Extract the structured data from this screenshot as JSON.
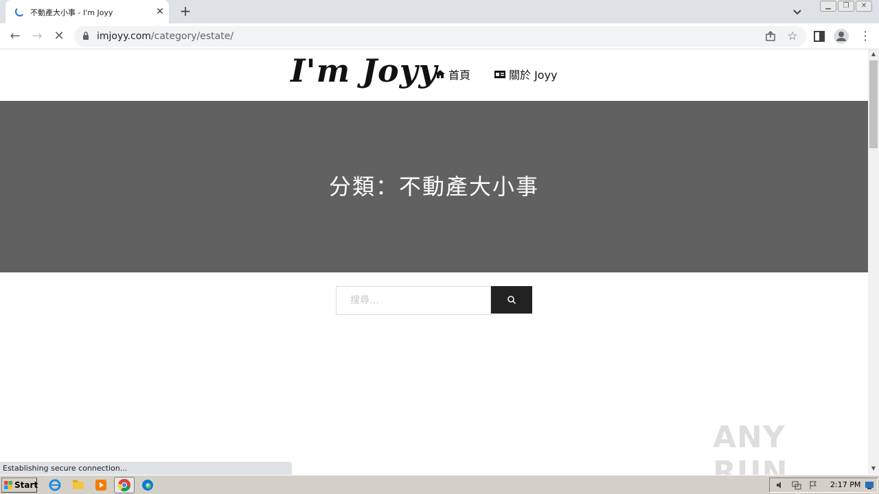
{
  "browser": {
    "tab_title": "不動產大小事 - I'm Joyy",
    "url_host": "imjoyy.com",
    "url_path": "/category/estate/",
    "status_text": "Establishing secure connection..."
  },
  "site": {
    "logo": "I'm Joyy",
    "nav": [
      {
        "label": "首頁",
        "icon": "home-icon"
      },
      {
        "label": "關於 Joyy",
        "icon": "id-card-icon"
      }
    ],
    "hero_title": "分類：不動產大小事",
    "search": {
      "placeholder": "搜尋…"
    }
  },
  "watermark": "ANY RUN",
  "taskbar": {
    "start_label": "Start",
    "clock": "2:17 PM"
  },
  "colors": {
    "hero_bg": "#616161",
    "search_button": "#222222"
  }
}
